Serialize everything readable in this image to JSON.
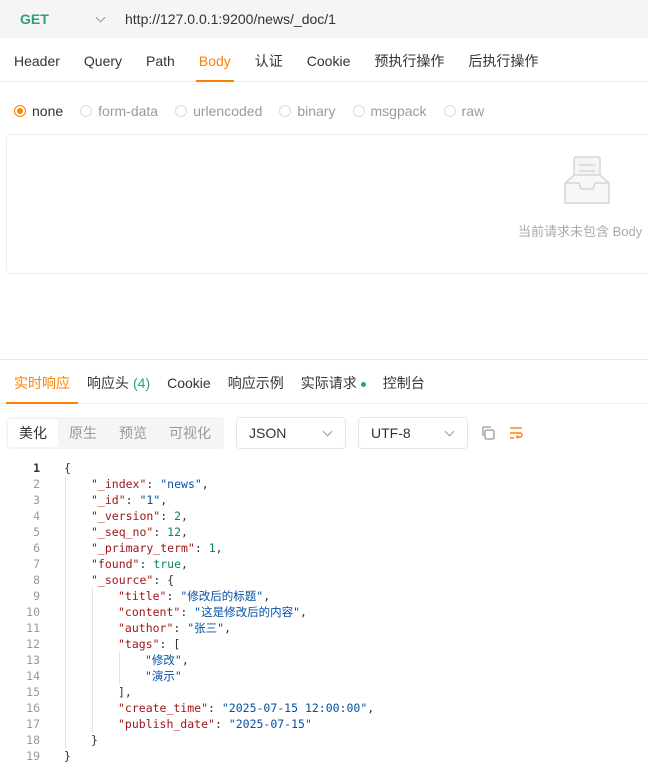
{
  "request": {
    "method": "GET",
    "url": "http://127.0.0.1:9200/news/_doc/1"
  },
  "request_tabs": [
    {
      "label": "Header",
      "active": false
    },
    {
      "label": "Query",
      "active": false
    },
    {
      "label": "Path",
      "active": false
    },
    {
      "label": "Body",
      "active": true
    },
    {
      "label": "认证",
      "active": false
    },
    {
      "label": "Cookie",
      "active": false
    },
    {
      "label": "预执行操作",
      "active": false
    },
    {
      "label": "后执行操作",
      "active": false
    }
  ],
  "body_types": [
    {
      "label": "none",
      "checked": true
    },
    {
      "label": "form-data",
      "checked": false
    },
    {
      "label": "urlencoded",
      "checked": false
    },
    {
      "label": "binary",
      "checked": false
    },
    {
      "label": "msgpack",
      "checked": false
    },
    {
      "label": "raw",
      "checked": false
    }
  ],
  "empty_body": {
    "message": "当前请求未包含 Body",
    "icon": "empty-inbox-icon"
  },
  "response_tabs": [
    {
      "label": "实时响应",
      "active": true
    },
    {
      "label": "响应头",
      "badge": "(4)",
      "active": false
    },
    {
      "label": "Cookie",
      "active": false
    },
    {
      "label": "响应示例",
      "active": false
    },
    {
      "label": "实际请求",
      "dot": true,
      "active": false
    },
    {
      "label": "控制台",
      "active": false
    }
  ],
  "view_modes": [
    {
      "label": "美化",
      "active": true
    },
    {
      "label": "原生",
      "active": false
    },
    {
      "label": "预览",
      "active": false
    },
    {
      "label": "可视化",
      "active": false
    }
  ],
  "format_select": {
    "value": "JSON"
  },
  "charset_select": {
    "value": "UTF-8"
  },
  "tools": {
    "copy_icon": "copy-icon",
    "wrap_icon": "word-wrap-icon"
  },
  "colors": {
    "accent": "#ff8000",
    "method": "#2ba471",
    "key": "#a31515",
    "string": "#0451a5",
    "number": "#098658"
  },
  "code_lines": [
    {
      "n": "1",
      "indent": 0,
      "tokens": [
        {
          "t": "{"
        }
      ]
    },
    {
      "n": "2",
      "indent": 1,
      "tokens": [
        {
          "t": "\"_index\"",
          "c": "k"
        },
        {
          "t": ": "
        },
        {
          "t": "\"news\"",
          "c": "s"
        },
        {
          "t": ","
        }
      ]
    },
    {
      "n": "3",
      "indent": 1,
      "tokens": [
        {
          "t": "\"_id\"",
          "c": "k"
        },
        {
          "t": ": "
        },
        {
          "t": "\"1\"",
          "c": "s"
        },
        {
          "t": ","
        }
      ]
    },
    {
      "n": "4",
      "indent": 1,
      "tokens": [
        {
          "t": "\"_version\"",
          "c": "k"
        },
        {
          "t": ": "
        },
        {
          "t": "2",
          "c": "n"
        },
        {
          "t": ","
        }
      ]
    },
    {
      "n": "5",
      "indent": 1,
      "tokens": [
        {
          "t": "\"_seq_no\"",
          "c": "k"
        },
        {
          "t": ": "
        },
        {
          "t": "12",
          "c": "n"
        },
        {
          "t": ","
        }
      ]
    },
    {
      "n": "6",
      "indent": 1,
      "tokens": [
        {
          "t": "\"_primary_term\"",
          "c": "k"
        },
        {
          "t": ": "
        },
        {
          "t": "1",
          "c": "n"
        },
        {
          "t": ","
        }
      ]
    },
    {
      "n": "7",
      "indent": 1,
      "tokens": [
        {
          "t": "\"found\"",
          "c": "k"
        },
        {
          "t": ": "
        },
        {
          "t": "true",
          "c": "n"
        },
        {
          "t": ","
        }
      ]
    },
    {
      "n": "8",
      "indent": 1,
      "tokens": [
        {
          "t": "\"_source\"",
          "c": "k"
        },
        {
          "t": ": {"
        }
      ]
    },
    {
      "n": "9",
      "indent": 2,
      "tokens": [
        {
          "t": "\"title\"",
          "c": "k"
        },
        {
          "t": ": "
        },
        {
          "t": "\"修改后的标题\"",
          "c": "s"
        },
        {
          "t": ","
        }
      ]
    },
    {
      "n": "10",
      "indent": 2,
      "tokens": [
        {
          "t": "\"content\"",
          "c": "k"
        },
        {
          "t": ": "
        },
        {
          "t": "\"这是修改后的内容\"",
          "c": "s"
        },
        {
          "t": ","
        }
      ]
    },
    {
      "n": "11",
      "indent": 2,
      "tokens": [
        {
          "t": "\"author\"",
          "c": "k"
        },
        {
          "t": ": "
        },
        {
          "t": "\"张三\"",
          "c": "s"
        },
        {
          "t": ","
        }
      ]
    },
    {
      "n": "12",
      "indent": 2,
      "tokens": [
        {
          "t": "\"tags\"",
          "c": "k"
        },
        {
          "t": ": ["
        }
      ]
    },
    {
      "n": "13",
      "indent": 3,
      "tokens": [
        {
          "t": "\"修改\"",
          "c": "s"
        },
        {
          "t": ","
        }
      ]
    },
    {
      "n": "14",
      "indent": 3,
      "tokens": [
        {
          "t": "\"演示\"",
          "c": "s"
        }
      ]
    },
    {
      "n": "15",
      "indent": 2,
      "tokens": [
        {
          "t": "],"
        }
      ]
    },
    {
      "n": "16",
      "indent": 2,
      "tokens": [
        {
          "t": "\"create_time\"",
          "c": "k"
        },
        {
          "t": ": "
        },
        {
          "t": "\"2025-07-15 12:00:00\"",
          "c": "s"
        },
        {
          "t": ","
        }
      ]
    },
    {
      "n": "17",
      "indent": 2,
      "tokens": [
        {
          "t": "\"publish_date\"",
          "c": "k"
        },
        {
          "t": ": "
        },
        {
          "t": "\"2025-07-15\"",
          "c": "s"
        }
      ]
    },
    {
      "n": "18",
      "indent": 1,
      "tokens": [
        {
          "t": "}"
        }
      ]
    },
    {
      "n": "19",
      "indent": 0,
      "tokens": [
        {
          "t": "}"
        }
      ]
    }
  ]
}
